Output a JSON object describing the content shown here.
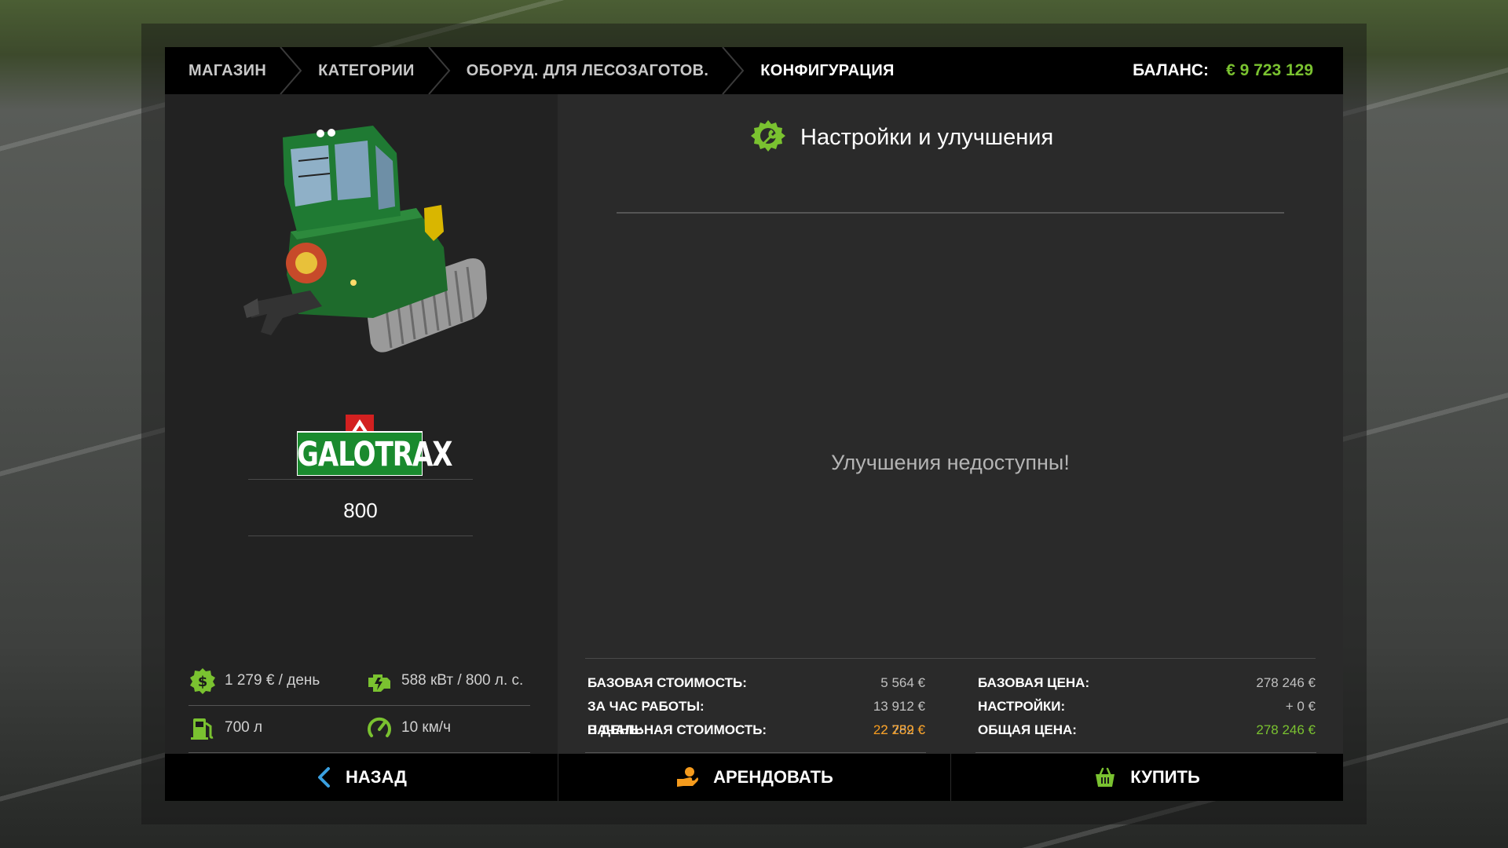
{
  "breadcrumb": [
    "МАГАЗИН",
    "КАТЕГОРИИ",
    "ОБОРУД. ДЛЯ ЛЕСОЗАГОТОВ.",
    "КОНФИГУРАЦИЯ"
  ],
  "balance": {
    "label": "БАЛАНС:",
    "value": "€ 9 723 129"
  },
  "vehicle": {
    "brand": "GALOTRAX",
    "model": "800",
    "stats": {
      "daily_cost": "1 279 € / день",
      "power": "588 кВт / 800 л. с.",
      "fuel": "700 л",
      "speed": "10 км/ч"
    }
  },
  "config": {
    "title": "Настройки и улучшения",
    "empty_message": "Улучшения недоступны!"
  },
  "lease": {
    "base_cost": {
      "label": "БАЗОВАЯ СТОИМОСТЬ:",
      "value": "5 564 €"
    },
    "per_hour": {
      "label": "ЗА ЧАС РАБОТЫ:",
      "value": "13 912 €"
    },
    "per_day": {
      "label": "В ДЕНЬ:",
      "value": "2 782 €"
    },
    "initial": {
      "label": "НАЧАЛЬНАЯ СТОИМОСТЬ:",
      "value": "22 259 €"
    }
  },
  "purchase": {
    "base_price": {
      "label": "БАЗОВАЯ ЦЕНА:",
      "value": "278 246 €"
    },
    "options": {
      "label": "НАСТРОЙКИ:",
      "value": "+ 0 €"
    },
    "total": {
      "label": "ОБЩАЯ ЦЕНА:",
      "value": "278 246 €"
    }
  },
  "buttons": {
    "back": "НАЗАД",
    "lease": "АРЕНДОВАТЬ",
    "buy": "КУПИТЬ"
  },
  "colors": {
    "accent_green": "#7ac230",
    "accent_orange": "#f59b1d",
    "back_blue": "#3aa0e0"
  }
}
